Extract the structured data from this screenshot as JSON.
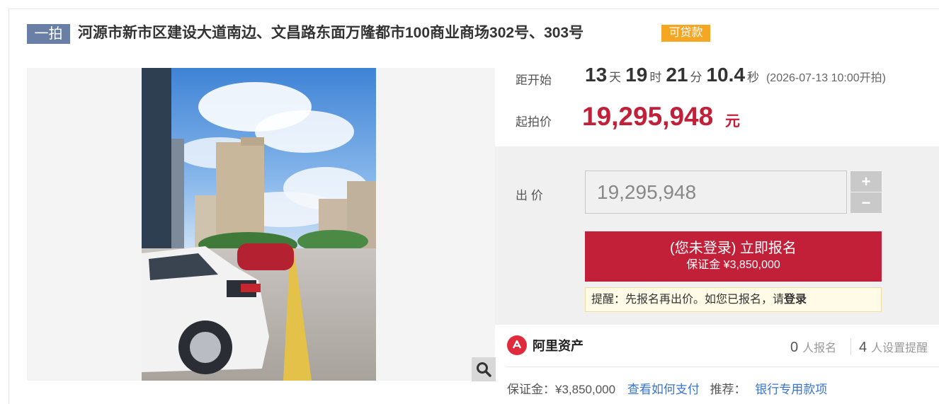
{
  "header": {
    "round_badge": "一拍",
    "title": "河源市新市区建设大道南边、文昌路东面万隆都市100商业商场302号、303号",
    "loan_badge": "可贷款"
  },
  "countdown": {
    "label": "距开始",
    "days": "13",
    "days_unit": "天",
    "hours": "19",
    "hours_unit": "时",
    "minutes": "21",
    "minutes_unit": "分",
    "seconds": "10.4",
    "seconds_unit": "秒",
    "start_time": "(2026-07-13 10:00开拍)"
  },
  "price": {
    "label": "起拍价",
    "value": "19,295,948",
    "unit": "元"
  },
  "bid": {
    "label": "出 价",
    "input_value": "19,295,948",
    "plus": "+",
    "minus": "−",
    "signup_main": "(您未登录) 立即报名",
    "signup_sub": "保证金 ¥3,850,000",
    "notice_text": "提醒：先报名再出价。如您已报名，请",
    "notice_link": "登录"
  },
  "footer": {
    "logo_text": "阿里资产",
    "signup_count": "0",
    "signup_label": "人报名",
    "reminder_count": "4",
    "reminder_label": "人设置提醒",
    "deposit_text": "保证金：¥3,850,000",
    "pay_link": "查看如何支付",
    "recommend_label": "推荐：",
    "bank_link": "银行专用款项"
  },
  "colors": {
    "accent_red": "#c21f38",
    "badge_blue": "#6a7fa6",
    "badge_orange": "#f5a623",
    "link_blue": "#3b74c9"
  }
}
